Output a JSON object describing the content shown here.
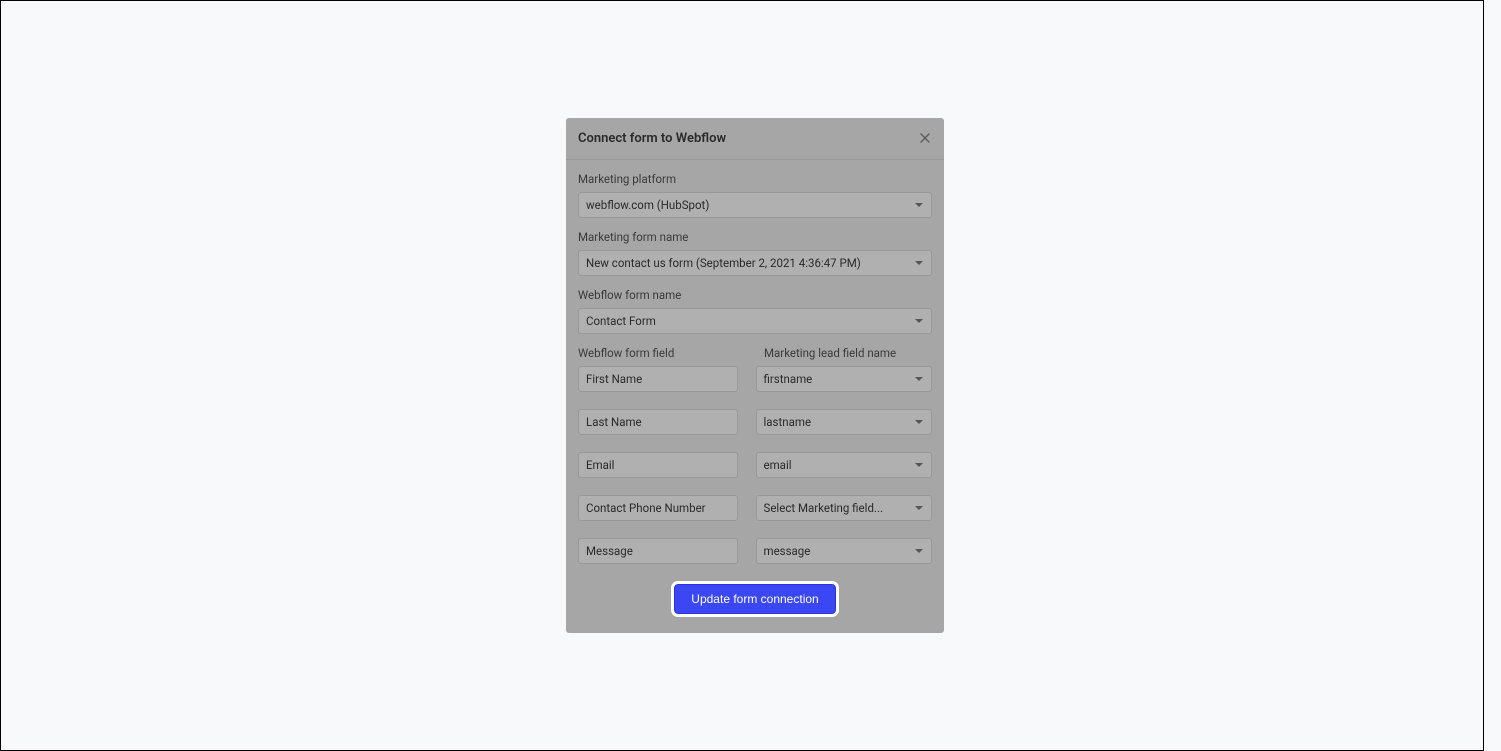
{
  "modal": {
    "title": "Connect form to Webflow",
    "fields": {
      "marketing_platform": {
        "label": "Marketing platform",
        "value": "webflow.com (HubSpot)"
      },
      "marketing_form_name": {
        "label": "Marketing form name",
        "value": "New contact us form (September 2, 2021 4:36:47 PM)"
      },
      "webflow_form_name": {
        "label": "Webflow form name",
        "value": "Contact Form"
      }
    },
    "mapping": {
      "webflow_header": "Webflow form field",
      "marketing_header": "Marketing lead field name",
      "rows": [
        {
          "webflow": "First Name",
          "marketing": "firstname"
        },
        {
          "webflow": "Last Name",
          "marketing": "lastname"
        },
        {
          "webflow": "Email",
          "marketing": "email"
        },
        {
          "webflow": "Contact Phone Number",
          "marketing": "Select Marketing field..."
        },
        {
          "webflow": "Message",
          "marketing": "message"
        }
      ]
    },
    "submit_label": "Update form connection"
  }
}
